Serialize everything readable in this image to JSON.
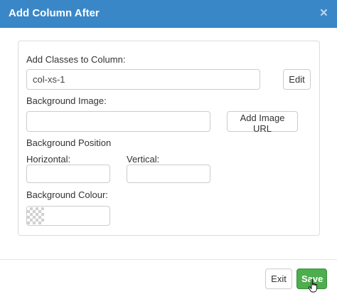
{
  "dialog": {
    "title": "Add Column After",
    "close_glyph": "×"
  },
  "form": {
    "classes_label": "Add Classes to Column:",
    "classes_value": "col-xs-1",
    "edit_button": "Edit",
    "background_image_label": "Background Image:",
    "background_image_value": "",
    "add_image_url_button": "Add Image URL",
    "background_position_label": "Background Position",
    "horizontal_label": "Horizontal:",
    "horizontal_value": "",
    "vertical_label": "Vertical:",
    "vertical_value": "",
    "background_colour_label": "Background Colour:",
    "background_colour_value": ""
  },
  "footer": {
    "exit_button": "Exit",
    "save_button": "Save"
  },
  "colors": {
    "header": "#3a87c8",
    "save": "#4cae4c"
  },
  "icons": {
    "close": "close-icon",
    "swatch": "transparent-swatch-icon",
    "cursor": "hand-cursor-icon"
  }
}
